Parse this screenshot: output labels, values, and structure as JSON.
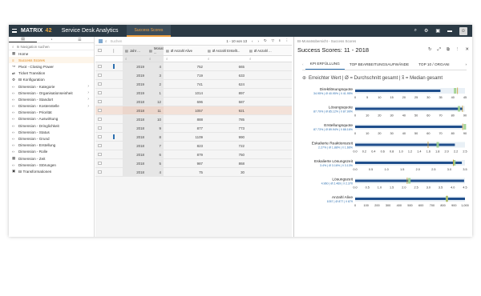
{
  "topbar": {
    "logo": "MATRIX",
    "logo_num": "42",
    "title": "Service Desk Analytics",
    "active_tab": "Success Scores"
  },
  "sidebar": {
    "search_placeholder": "In Navigation suchen",
    "items": [
      {
        "label": "Home",
        "icon": "home-icon",
        "active": false,
        "chevron": false
      },
      {
        "label": "Success Scores",
        "icon": "chart-icon",
        "active": true,
        "chevron": false
      },
      {
        "label": "Pivot - Closing Power",
        "icon": "trend-icon",
        "active": false,
        "chevron": false
      },
      {
        "label": "Ticket Transition",
        "icon": "transition-icon",
        "active": false,
        "chevron": false
      },
      {
        "label": "BI Konfiguration",
        "icon": "gear-icon",
        "active": false,
        "chevron": false
      },
      {
        "label": "Dimension - Kategorie",
        "icon": "code-icon",
        "active": false,
        "chevron": true
      },
      {
        "label": "Dimension - Organisationseinheit",
        "icon": "code-icon",
        "active": false,
        "chevron": true
      },
      {
        "label": "Dimension - Standort",
        "icon": "code-icon",
        "active": false,
        "chevron": true
      },
      {
        "label": "Dimension - Kostenstelle",
        "icon": "code-icon",
        "active": false,
        "chevron": true
      },
      {
        "label": "Dimension - Priorität",
        "icon": "code-icon",
        "active": false,
        "chevron": false
      },
      {
        "label": "Dimension - Auswirkung",
        "icon": "code-icon",
        "active": false,
        "chevron": false
      },
      {
        "label": "Dimension - Dringlichkeit",
        "icon": "code-icon",
        "active": false,
        "chevron": false
      },
      {
        "label": "Dimension - Status",
        "icon": "code-icon",
        "active": false,
        "chevron": false
      },
      {
        "label": "Dimension - Grund",
        "icon": "code-icon",
        "active": false,
        "chevron": false
      },
      {
        "label": "Dimension - Erstellung",
        "icon": "code-icon",
        "active": false,
        "chevron": false
      },
      {
        "label": "Dimension - Rolle",
        "icon": "code-icon",
        "active": false,
        "chevron": false
      },
      {
        "label": "Dimension - Zeit",
        "icon": "calendar-icon",
        "active": false,
        "chevron": false
      },
      {
        "label": "Dimension - Störungen",
        "icon": "code-icon",
        "active": false,
        "chevron": false
      },
      {
        "label": "BI Transformationen",
        "icon": "transform-icon",
        "active": false,
        "chevron": false
      }
    ]
  },
  "grid": {
    "search_placeholder": "Suchen",
    "pager": "1 - 10 von 13",
    "headers": [
      "Jahr ...",
      "Monat ...",
      "Ø Anzahl Alive",
      "Ø Anzahl Erstellt...",
      "Ø Anzahl ..."
    ],
    "rows": [
      {
        "jahr": "2019",
        "monat": "4",
        "alive": "752",
        "erstellt": "665",
        "marked": true,
        "hl": false
      },
      {
        "jahr": "2019",
        "monat": "3",
        "alive": "719",
        "erstellt": "633",
        "marked": false,
        "hl": false
      },
      {
        "jahr": "2019",
        "monat": "2",
        "alive": "741",
        "erstellt": "624",
        "marked": false,
        "hl": false
      },
      {
        "jahr": "2019",
        "monat": "1",
        "alive": "1014",
        "erstellt": "897",
        "marked": false,
        "hl": false
      },
      {
        "jahr": "2018",
        "monat": "12",
        "alive": "696",
        "erstellt": "587",
        "marked": false,
        "hl": false
      },
      {
        "jahr": "2018",
        "monat": "11",
        "alive": "1057",
        "erstellt": "921",
        "marked": false,
        "hl": true
      },
      {
        "jahr": "2018",
        "monat": "10",
        "alive": "888",
        "erstellt": "785",
        "marked": false,
        "hl": false
      },
      {
        "jahr": "2018",
        "monat": "9",
        "alive": "877",
        "erstellt": "773",
        "marked": false,
        "hl": false
      },
      {
        "jahr": "2018",
        "monat": "8",
        "alive": "1109",
        "erstellt": "990",
        "marked": true,
        "hl": false
      },
      {
        "jahr": "2018",
        "monat": "7",
        "alive": "823",
        "erstellt": "722",
        "marked": false,
        "hl": false
      },
      {
        "jahr": "2018",
        "monat": "6",
        "alive": "879",
        "erstellt": "750",
        "marked": false,
        "hl": false
      },
      {
        "jahr": "2018",
        "monat": "5",
        "alive": "987",
        "erstellt": "868",
        "marked": false,
        "hl": false
      },
      {
        "jahr": "2018",
        "monat": "4",
        "alive": "75",
        "erstellt": "30",
        "marked": false,
        "hl": false
      }
    ]
  },
  "detail": {
    "breadcrumb": "BI-Monatsübersicht - Success Scores",
    "title": "Success Scores: 11 - 2018",
    "tabs": [
      "KPI ERFÜLLUNG",
      "TOP BEARBEITUNGSAUFWÄNDE",
      "TOP 10 / ORGANI"
    ],
    "chart_heading": "Erreichter Wert | Ø = Durchschnitt gesamt | x̃ = Median gesamt"
  },
  "chart_data": {
    "type": "bullet",
    "rows": [
      {
        "label": "Direktlösungsquote",
        "sub": "34.95% | Ø 40.95% | x̃ 41.95%",
        "value": 34.95,
        "avg": 40.95,
        "median": 41.95,
        "ticks": [
          "0",
          "5",
          "10",
          "15",
          "20",
          "25",
          "30",
          "35",
          "40",
          "45"
        ],
        "max": 45
      },
      {
        "label": "Lösungsquote",
        "sub": "87.79% | Ø 85.12% | x̃ 87.99%",
        "value": 87.79,
        "avg": 85.12,
        "median": 87.99,
        "ticks": [
          "0",
          "10",
          "20",
          "30",
          "40",
          "50",
          "60",
          "70",
          "80",
          "90"
        ],
        "max": 90
      },
      {
        "label": "Erstellungsquote",
        "sub": "87.73% | Ø 89.94% | x̃ 88.16%",
        "value": 87.73,
        "avg": 89.94,
        "median": 88.16,
        "ticks": [
          "0",
          "10",
          "20",
          "30",
          "40",
          "50",
          "60",
          "70",
          "80",
          "90"
        ],
        "max": 90
      },
      {
        "label": "Eskalierte Reaktionszeit",
        "sub": "2.27% | Ø 1.88% | x̃ 1.66%",
        "value": 2.27,
        "avg": 1.88,
        "median": 1.66,
        "ticks": [
          "0.0",
          "0.2",
          "0.4",
          "0.6",
          "0.8",
          "1.0",
          "1.2",
          "1.4",
          "1.6",
          "1.8",
          "2.0",
          "2.2",
          "2.5"
        ],
        "max": 2.5
      },
      {
        "label": "Eskalierte Lösungszeit",
        "sub": "3.4% | Ø 3.16% | x̃ 3.13%",
        "value": 3.4,
        "avg": 3.16,
        "median": 3.13,
        "ticks": [
          "0.0",
          "0.5",
          "1.0",
          "1.5",
          "2.0",
          "2.5",
          "3.0",
          "3.5"
        ],
        "max": 3.5
      },
      {
        "label": "Lösungszeit",
        "sub": "4.960 | Ø 2.469 | x̃ 2.370",
        "value": 4.96,
        "avg": 2.469,
        "median": 2.37,
        "ticks": [
          "0.0",
          "0.5",
          "1.0",
          "1.5",
          "2.0",
          "2.5",
          "3.0",
          "3.5",
          "4.0",
          "4.5"
        ],
        "max": 5
      },
      {
        "label": "Anzahl Alive",
        "sub": "1057 | Ø 877 | x̃ 879",
        "value": 1057,
        "avg": 877,
        "median": 879,
        "ticks": [
          "0",
          "100",
          "200",
          "300",
          "400",
          "500",
          "600",
          "700",
          "800",
          "900",
          "1,000"
        ],
        "max": 1050
      }
    ]
  }
}
